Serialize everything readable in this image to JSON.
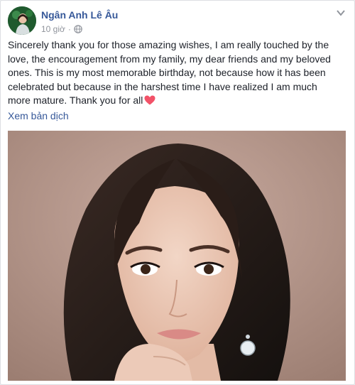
{
  "post": {
    "author": {
      "name": "Ngân Anh Lê Âu",
      "avatar": "avatar"
    },
    "meta": {
      "time": "10 giờ",
      "audience_icon": "globe-icon"
    },
    "options_icon": "chevron-down-icon",
    "text": "Sincerely thank you for those amazing wishes, I am really touched by the love, the encouragement from my family, my dear friends and my beloved ones. This is my most memorable birthday, not because how it has been celebrated but because in the harshest time I have realized I am much more mature. Thank you for all",
    "emoji": "heart-icon",
    "translate_label": "Xem bản dịch",
    "photo": "portrait-photo"
  },
  "colors": {
    "link": "#365899",
    "text": "#1d2129",
    "meta": "#90949c",
    "heart": "#f25268",
    "photo_background": "#a88a7e"
  }
}
